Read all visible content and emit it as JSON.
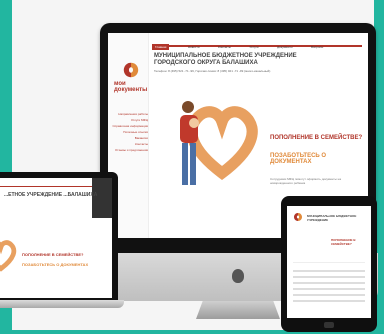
{
  "imac": {
    "logo_text": "мои документы",
    "nav": [
      "Главная",
      "Новости",
      "Контакты",
      "Услуги",
      "Документы",
      "Вопросы"
    ],
    "title_line1": "МУНИЦИПАЛЬНОЕ БЮДЖЕТНОЕ УЧРЕЖДЕНИЕ",
    "title_line2": "ГОРОДСКОГО ОКРУГА БАЛАШИХА",
    "contact": "Телефон: 8 (495) 521 -71 -99, Горячая линия: 8 (495) 021 -71 -99 (много-канальный)",
    "sidebar_links": [
      "Направления работы",
      "Услуги МФЦ",
      "Справочная информация",
      "Полезные ссылки",
      "Вакансии",
      "Контакты",
      "Отзывы и предложения"
    ],
    "banner_heading": "ПОПОЛНЕНИЕ В СЕМЕЙСТВЕ?",
    "banner_subheading": "ПОЗАБОТЬТЕСЬ О ДОКУМЕНТАХ",
    "banner_note": "Сотрудники МФЦ помогут оформить документы на новорожденного ребенка"
  },
  "laptop": {
    "title": "...ЕТНОЕ УЧРЕЖДЕНИЕ ...БАЛАШИХА",
    "heading": "ПОПОЛНЕНИЕ В СЕМЕЙСТВЕ?",
    "subheading": "ПОЗАБОТЬТЕСЬ О ДОКУМЕНТАХ"
  },
  "tablet": {
    "title": "МУНИЦИПАЛЬНОЕ БЮДЖЕТНОЕ УЧРЕЖДЕНИЕ",
    "heading": "ПОПОЛНЕНИЕ В СЕМЕЙСТВЕ?"
  },
  "colors": {
    "brand_red": "#b1352a",
    "accent_orange": "#e08a3a",
    "background_teal": "#22b6a0"
  }
}
